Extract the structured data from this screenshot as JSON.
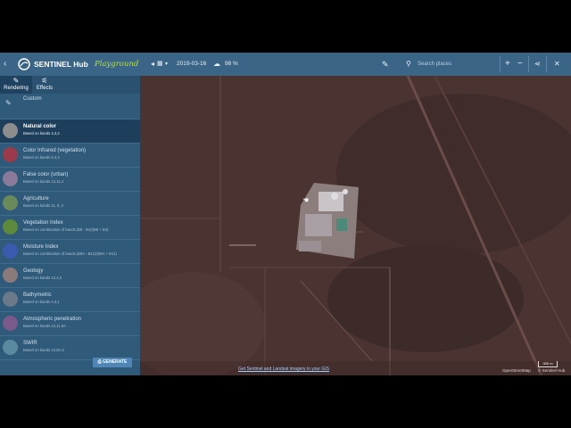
{
  "header": {
    "brand": "SENTINEL Hub",
    "playground": "Playground",
    "date": "2019-03-16",
    "cloud_coverage": "98 %",
    "search_placeholder": "Search places"
  },
  "tabs": [
    {
      "label": "Rendering",
      "icon": "brush-icon"
    },
    {
      "label": "Effects",
      "icon": "sliders-icon"
    }
  ],
  "custom_label": "Custom",
  "layers": [
    {
      "name": "Natural color",
      "desc": "Based on bands 4,3,2",
      "color": "#8d8d8d"
    },
    {
      "name": "Color Infrared (vegetation)",
      "desc": "Based on bands 8,4,3",
      "color": "#9a3a4a"
    },
    {
      "name": "False color (urban)",
      "desc": "Based on bands 12,11,4",
      "color": "#8a7a9a"
    },
    {
      "name": "Agriculture",
      "desc": "Based on bands 11, 8, 2",
      "color": "#6a8a5a"
    },
    {
      "name": "Vegetation Index",
      "desc": "Based on combination of bands (B8 - B4)/(B8 + B4)",
      "color": "#5a8a3a"
    },
    {
      "name": "Moisture Index",
      "desc": "Based on combination of bands (B8A - B11)/(B8A + B11)",
      "color": "#3a5ab0"
    },
    {
      "name": "Geology",
      "desc": "Based on bands 12,4,2",
      "color": "#8a7a7a"
    },
    {
      "name": "Bathymetric",
      "desc": "Based on bands 4,3,1",
      "color": "#6a7a8a"
    },
    {
      "name": "Atmospheric penetration",
      "desc": "Based on bands 12,11,8A",
      "color": "#7a5a8a"
    },
    {
      "name": "SWIR",
      "desc": "Based on bands 12,8A,4",
      "color": "#5a8aa0"
    }
  ],
  "generate_label": "GENERATE",
  "map": {
    "footer_link": "Get Sentinel and Landsat imagery in your GIS",
    "scale": "300 m",
    "attribution_osm": "OpenStreetMap",
    "attribution_sh": "© Sentinel Hub"
  }
}
